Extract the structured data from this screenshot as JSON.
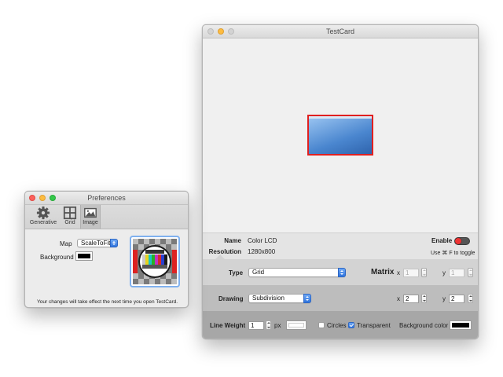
{
  "preferences": {
    "title": "Preferences",
    "toolbar": [
      {
        "label": "Generative",
        "icon": "gear-icon"
      },
      {
        "label": "Grid",
        "icon": "grid-icon"
      },
      {
        "label": "Image",
        "icon": "image-icon",
        "selected": true
      }
    ],
    "map_label": "Map",
    "map_value": "ScaleToFit",
    "background_label": "Background",
    "background_color": "#000000",
    "note": "Your changes will take effect the next time you open TestCard."
  },
  "testcard": {
    "title": "TestCard",
    "info": {
      "name_label": "Name",
      "name_value": "Color LCD",
      "resolution_label": "Resolution",
      "resolution_value": "1280x800",
      "enable_label": "Enable",
      "toggle_hint": "Use ⌘ F to toggle"
    },
    "type_row": {
      "type_label": "Type",
      "type_value": "Grid",
      "matrix_label": "Matrix",
      "x_label": "x",
      "x_value": "1",
      "y_label": "y",
      "y_value": "1"
    },
    "drawing_row": {
      "drawing_label": "Drawing",
      "drawing_value": "Subdivision",
      "x_label": "x",
      "x_value": "2",
      "y_label": "y",
      "y_value": "2"
    },
    "line_row": {
      "line_weight_label": "Line Weight",
      "line_weight_value": "1",
      "px_label": "px",
      "line_color": "#ffffff",
      "circles_label": "Circles",
      "circles_checked": false,
      "transparent_label": "Transparent",
      "transparent_checked": true,
      "background_color_label": "Background color",
      "background_color": "#000000"
    },
    "preview": {
      "border_color": "#e02020",
      "fill_top": "#8fbdf0",
      "fill_bottom": "#2f68b4"
    }
  },
  "colors": {
    "accent": "#2f74dd",
    "close": "#fc605c",
    "minimize": "#fdbc40",
    "zoom": "#34c84a"
  }
}
